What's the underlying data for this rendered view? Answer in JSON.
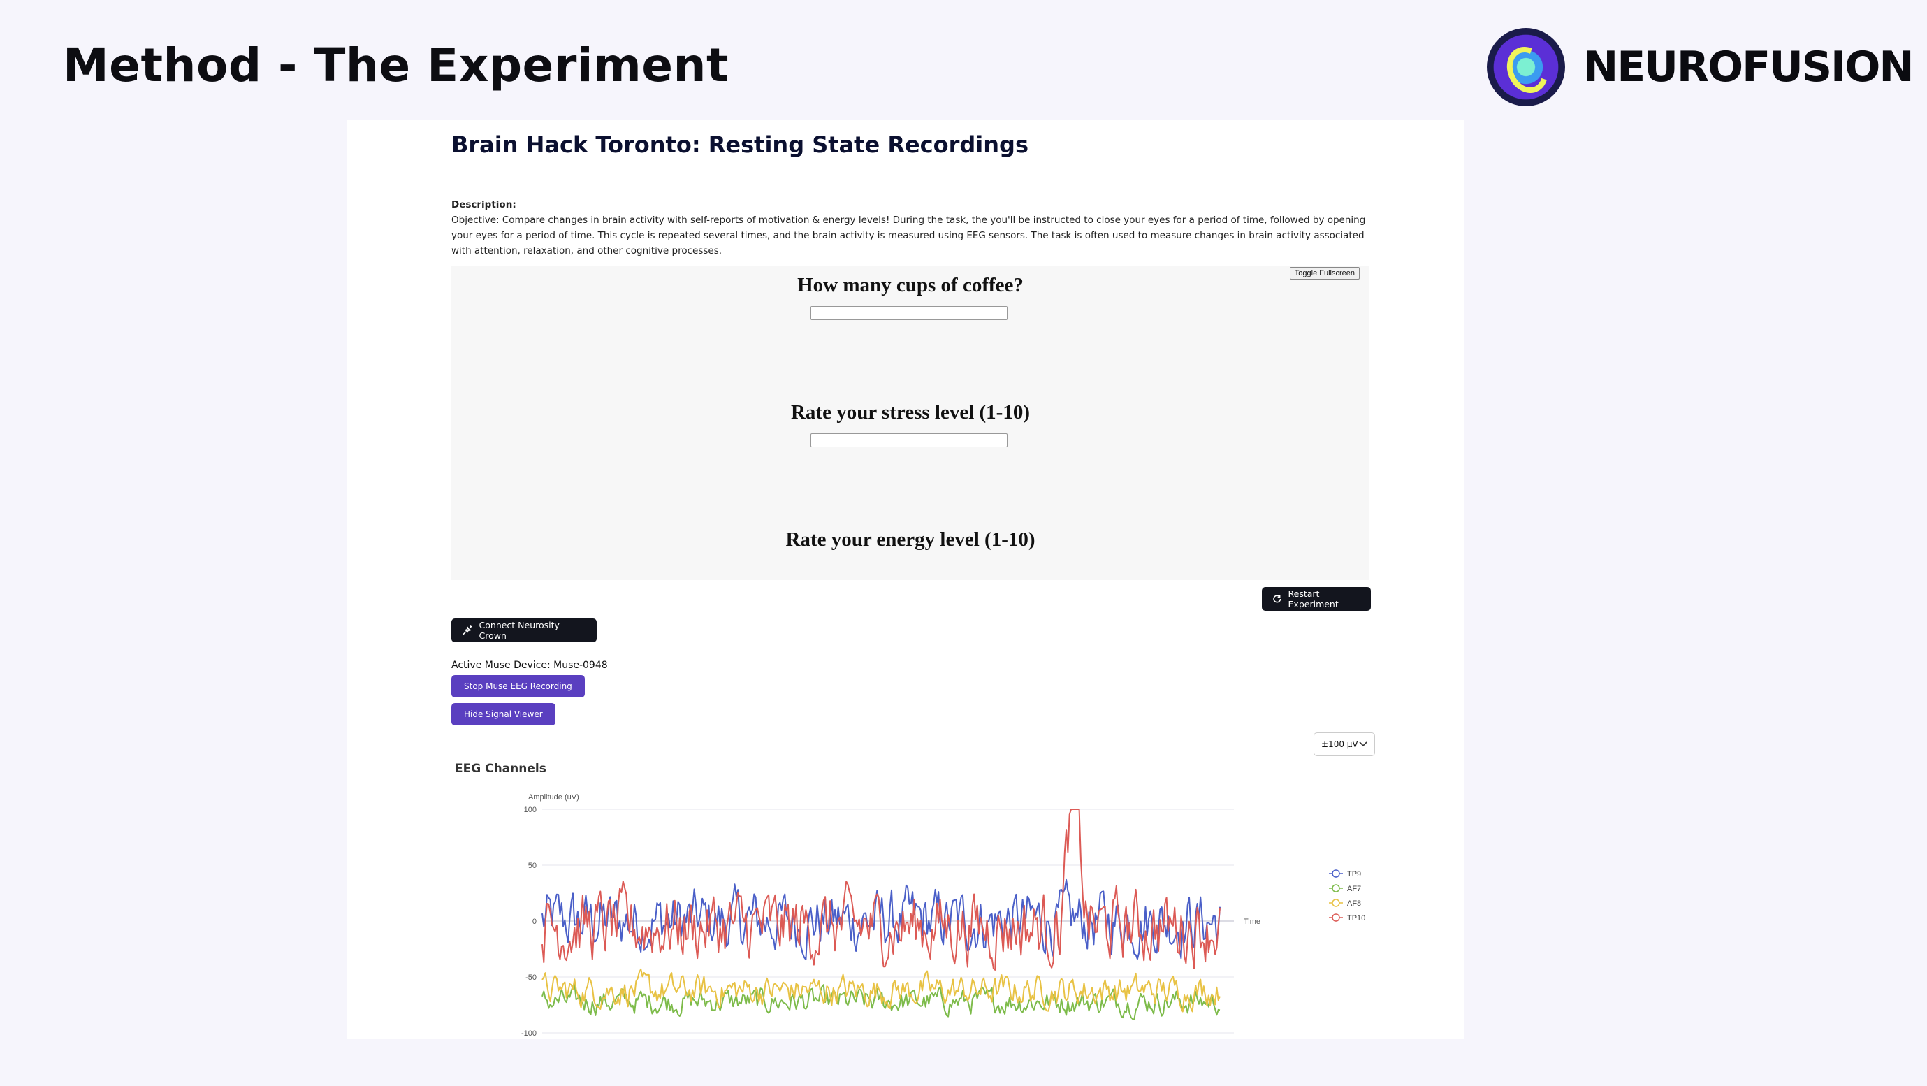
{
  "slide": {
    "title": "Method - The Experiment",
    "brand": "NEUROFUSION"
  },
  "experiment": {
    "title": "Brain Hack Toronto: Resting State Recordings",
    "description_label": "Description:",
    "description_text": "Objective: Compare changes in brain activity with self-reports of motivation & energy levels! During the task, the you'll be instructed to close your eyes for a period of time, followed by opening your eyes for a period of time. This cycle is repeated several times, and the brain activity is measured using EEG sensors. The task is often used to measure changes in brain activity associated with attention, relaxation, and other cognitive processes."
  },
  "survey": {
    "fullscreen_label": "Toggle Fullscreen",
    "q1": "How many cups of coffee?",
    "q2": "Rate your stress level (1-10)",
    "q3": "Rate your energy level (1-10)"
  },
  "controls": {
    "restart_label": "Restart Experiment",
    "connect_label": "Connect Neurosity Crown",
    "device_label": "Active Muse Device: Muse-0948",
    "stop_label": "Stop Muse EEG Recording",
    "hide_label": "Hide Signal Viewer",
    "range_value": "±100 µV"
  },
  "chart_data": {
    "type": "line",
    "title": "EEG Channels",
    "ylabel": "Amplitude (uV)",
    "xlabel": "Time",
    "ylim": [
      -100,
      100
    ],
    "yticks": [
      100,
      50,
      0,
      -50,
      -100
    ],
    "grid": true,
    "legend_position": "right",
    "series": [
      {
        "name": "TP9",
        "color": "#4a5fc8",
        "base": 0,
        "amp": 22
      },
      {
        "name": "AF7",
        "color": "#7dbb4a",
        "base": -72,
        "amp": 9
      },
      {
        "name": "AF8",
        "color": "#e8c244",
        "base": -62,
        "amp": 11
      },
      {
        "name": "TP10",
        "color": "#dc5a55",
        "base": -5,
        "amp": 25
      }
    ],
    "samples": 420
  }
}
